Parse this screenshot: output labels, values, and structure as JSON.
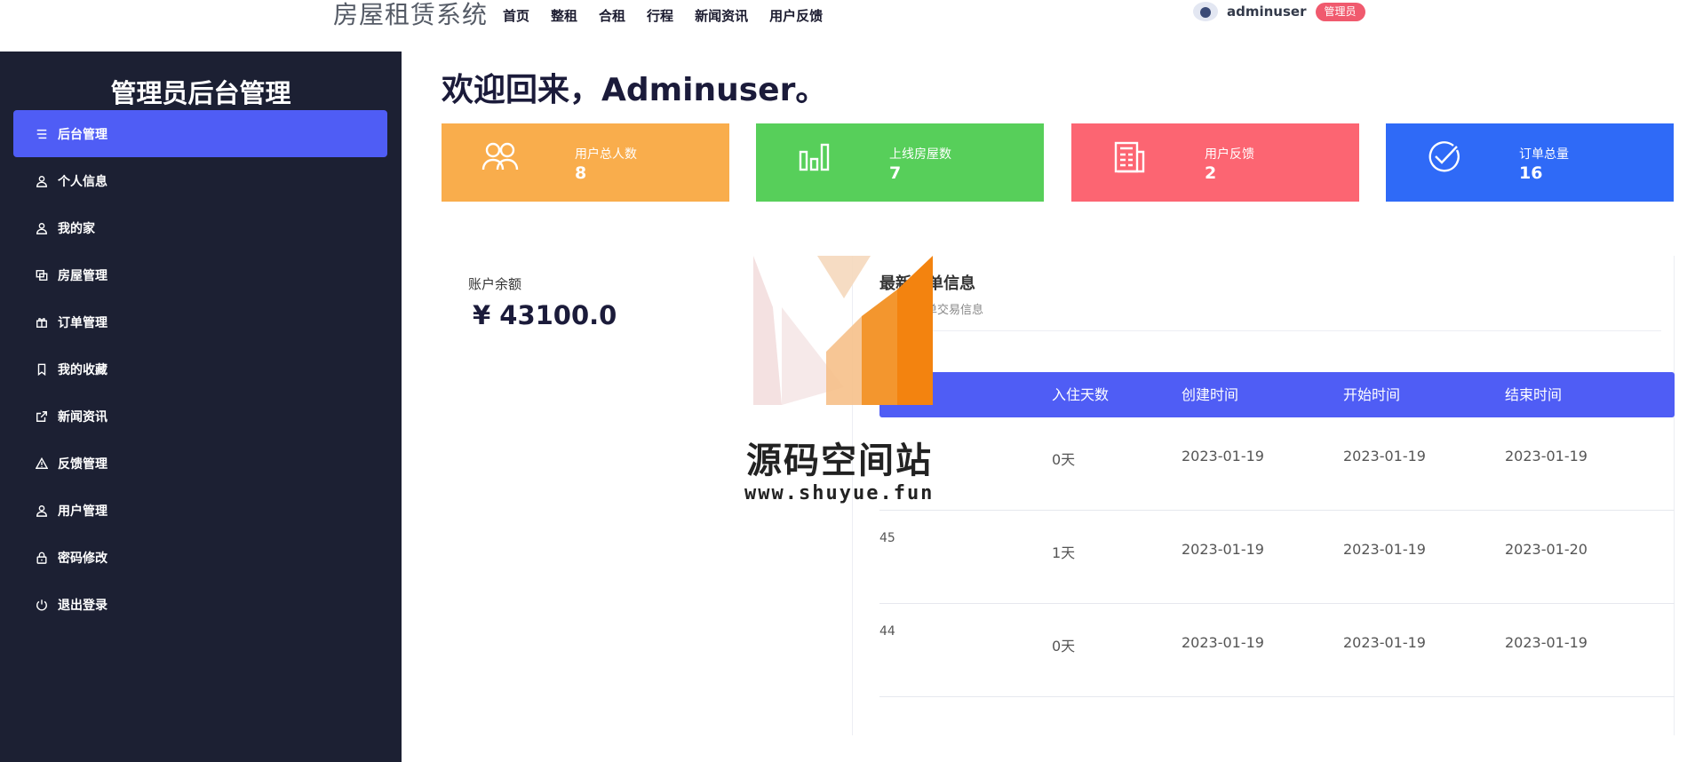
{
  "topnav": {
    "brand": "房屋租赁系统",
    "links": [
      "首页",
      "整租",
      "合租",
      "行程",
      "新闻资讯",
      "用户反馈"
    ],
    "username": "adminuser",
    "role": "管理员"
  },
  "sidebar": {
    "title": "管理员后台管理",
    "items": [
      {
        "label": "后台管理",
        "icon": "menu-lines-icon",
        "active": true
      },
      {
        "label": "个人信息",
        "icon": "user-icon"
      },
      {
        "label": "我的家",
        "icon": "user-icon"
      },
      {
        "label": "房屋管理",
        "icon": "copy-icon"
      },
      {
        "label": "订单管理",
        "icon": "gift-icon"
      },
      {
        "label": "我的收藏",
        "icon": "bookmark-icon"
      },
      {
        "label": "新闻资讯",
        "icon": "external-link-icon"
      },
      {
        "label": "反馈管理",
        "icon": "warning-icon"
      },
      {
        "label": "用户管理",
        "icon": "user-icon"
      },
      {
        "label": "密码修改",
        "icon": "lock-icon"
      },
      {
        "label": "退出登录",
        "icon": "power-icon"
      }
    ]
  },
  "main": {
    "welcome": "欢迎回来，Adminuser。",
    "stats": [
      {
        "label": "用户总人数",
        "value": "8",
        "color": "#f9ad4c",
        "icon": "users-icon"
      },
      {
        "label": "上线房屋数",
        "value": "7",
        "color": "#57cf5a",
        "icon": "bar-chart-icon"
      },
      {
        "label": "用户反馈",
        "value": "2",
        "color": "#fc6572",
        "icon": "newspaper-icon"
      },
      {
        "label": "订单总量",
        "value": "16",
        "color": "#2f6af7",
        "icon": "check-circle-icon"
      }
    ],
    "balance": {
      "label": "账户余额",
      "value": "¥ 43100.0"
    },
    "orders": {
      "title": "最新订单信息",
      "subtitle": "最新的订单交易信息",
      "columns": [
        "入住天数",
        "创建时间",
        "开始时间",
        "结束时间"
      ],
      "rows": [
        {
          "id": "",
          "days": "0天",
          "created": "2023-01-19",
          "start": "2023-01-19",
          "end": "2023-01-19"
        },
        {
          "id": "45",
          "days": "1天",
          "created": "2023-01-19",
          "start": "2023-01-19",
          "end": "2023-01-20"
        },
        {
          "id": "44",
          "days": "0天",
          "created": "2023-01-19",
          "start": "2023-01-19",
          "end": "2023-01-19"
        }
      ]
    }
  },
  "watermark": {
    "text": "源码空间站",
    "url": "www.shuyue.fun"
  },
  "colors": {
    "sidebar_bg": "#1c2033",
    "accent": "#4f5df5",
    "badge": "#f05a6e"
  }
}
